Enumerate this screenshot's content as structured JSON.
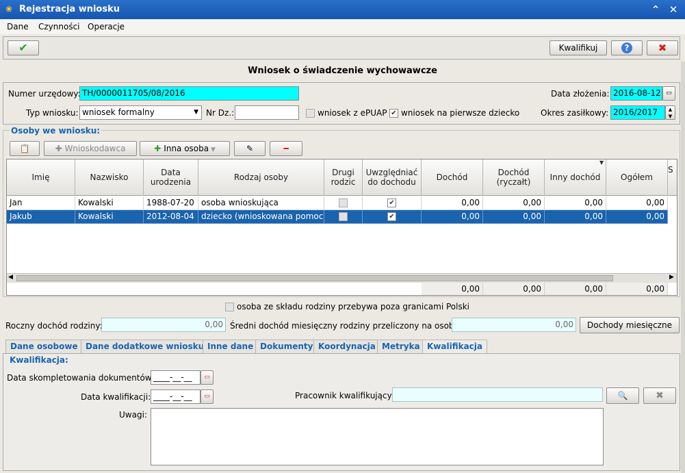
{
  "window": {
    "title": "Rejestracja wniosku",
    "app_icon": "app-icon",
    "min": "⌃",
    "close": "✕"
  },
  "menu": [
    "Dane",
    "Czynności",
    "Operacje"
  ],
  "toolbar": {
    "ok_icon": "✔",
    "kwalifikuj": "Kwalifikuj",
    "help_icon": "?",
    "cancel_icon": "✖"
  },
  "heading": "Wniosek o świadczenie wychowawcze",
  "form": {
    "numer_label": "Numer urzędowy:",
    "numer_value": "TH/0000011705/08/2016",
    "data_zlozenia_label": "Data złożenia:",
    "data_zlozenia_value": "2016-08-12",
    "typ_label": "Typ wniosku:",
    "typ_value": "wniosek formalny",
    "nrdz_label": "Nr Dz.:",
    "nrdz_value": "",
    "epuap_label": "wniosek z ePUAP",
    "pierwsze_label": "wniosek na pierwsze dziecko",
    "okres_label": "Okres zasiłkowy:",
    "okres_value": "2016/2017"
  },
  "osoby": {
    "title": "Osoby we wniosku:",
    "btn_wnioskodawca": "Wnioskodawca",
    "btn_inna": "Inna osoba",
    "headers": [
      "Imię",
      "Nazwisko",
      "Data urodzenia",
      "Rodzaj osoby",
      "Drugi rodzic",
      "Uwzględniać do dochodu",
      "Dochód",
      "Dochód (ryczałt)",
      "Inny dochód",
      "Ogółem",
      "S"
    ],
    "rows": [
      {
        "imie": "Jan",
        "nazwisko": "Kowalski",
        "data": "1988-07-20",
        "rodzaj": "osoba wnioskująca",
        "drugi": "",
        "uwzgl": "✔",
        "dochod": "0,00",
        "ryczalt": "0,00",
        "inny": "0,00",
        "ogolem": "0,00"
      },
      {
        "imie": "Jakub",
        "nazwisko": "Kowalski",
        "data": "2012-08-04",
        "rodzaj": "dziecko (wnioskowana pomoc)",
        "drugi": "",
        "uwzgl": "✔",
        "dochod": "0,00",
        "ryczalt": "0,00",
        "inny": "0,00",
        "ogolem": "0,00"
      }
    ],
    "totals": [
      "0,00",
      "0,00",
      "0,00",
      "0,00"
    ]
  },
  "poza_label": "osoba ze składu rodziny przebywa poza granicami Polski",
  "dochody": {
    "roczny_label": "Roczny dochód rodziny:",
    "roczny_value": "0,00",
    "sredni_label": "Średni dochód miesięczny rodziny przeliczony na osobę:",
    "sredni_value": "0,00",
    "btn": "Dochody miesięczne"
  },
  "tabs": [
    "Dane osobowe",
    "Dane dodatkowe wniosku",
    "Inne dane",
    "Dokumenty",
    "Koordynacja",
    "Metryka",
    "Kwalifikacja"
  ],
  "kwal": {
    "title": "Kwalifikacja:",
    "data_kompl_label": "Data skompletowania dokumentów:",
    "data_kompl_value": "____-__-__",
    "data_kwal_label": "Data kwalifikacji:",
    "data_kwal_value": "____-__-__",
    "pracownik_label": "Pracownik kwalifikujący:",
    "pracownik_value": "",
    "uwagi_label": "Uwagi:",
    "uwagi_value": ""
  },
  "colors": {
    "title_bg": "#1656b0",
    "cyan_field": "#00ffff",
    "selected_row": "#1a63ad",
    "section_title": "#1a64b0"
  }
}
